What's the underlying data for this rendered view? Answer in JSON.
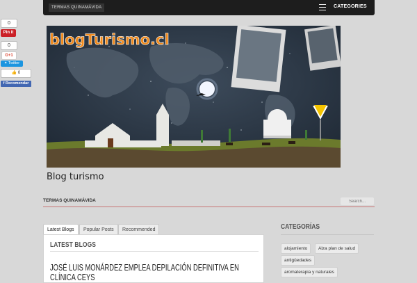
{
  "topbar": {
    "menu_item": "TERMAS QUINAMÁVIDA",
    "categories_label": "CATEGORIES"
  },
  "social": {
    "counter_1": "0",
    "pinterest": "Pin it",
    "counter_2": "0",
    "gplus": "G+1",
    "twitter": "Twitter",
    "like_count": "0",
    "facebook": "Recomendar"
  },
  "banner": {
    "logo_text": "blogTurismo.cl"
  },
  "site": {
    "title": "Blog turismo"
  },
  "nav": {
    "item": "TERMAS QUINAMÁVIDA",
    "search_placeholder": "Search..."
  },
  "tabs": [
    "Latest Blogs",
    "Popular Posts",
    "Recommended"
  ],
  "main": {
    "section_title": "LATEST BLOGS",
    "post_title": "JOSÉ LUIS MONÁRDEZ EMPLEA DEPILACIÓN DEFINITIVA EN CLÍNICA CEYS"
  },
  "sidebar": {
    "title": "CATEGORÍAS",
    "tags": [
      "alojamiento",
      "Alza plan de salud",
      "antigüedades",
      "aromaterapia y naturales"
    ]
  },
  "colors": {
    "topbar": "#1d1d1d",
    "accent_line": "#c87474",
    "pinterest": "#cb2027",
    "twitter": "#1b95e0",
    "facebook": "#4267b2"
  }
}
